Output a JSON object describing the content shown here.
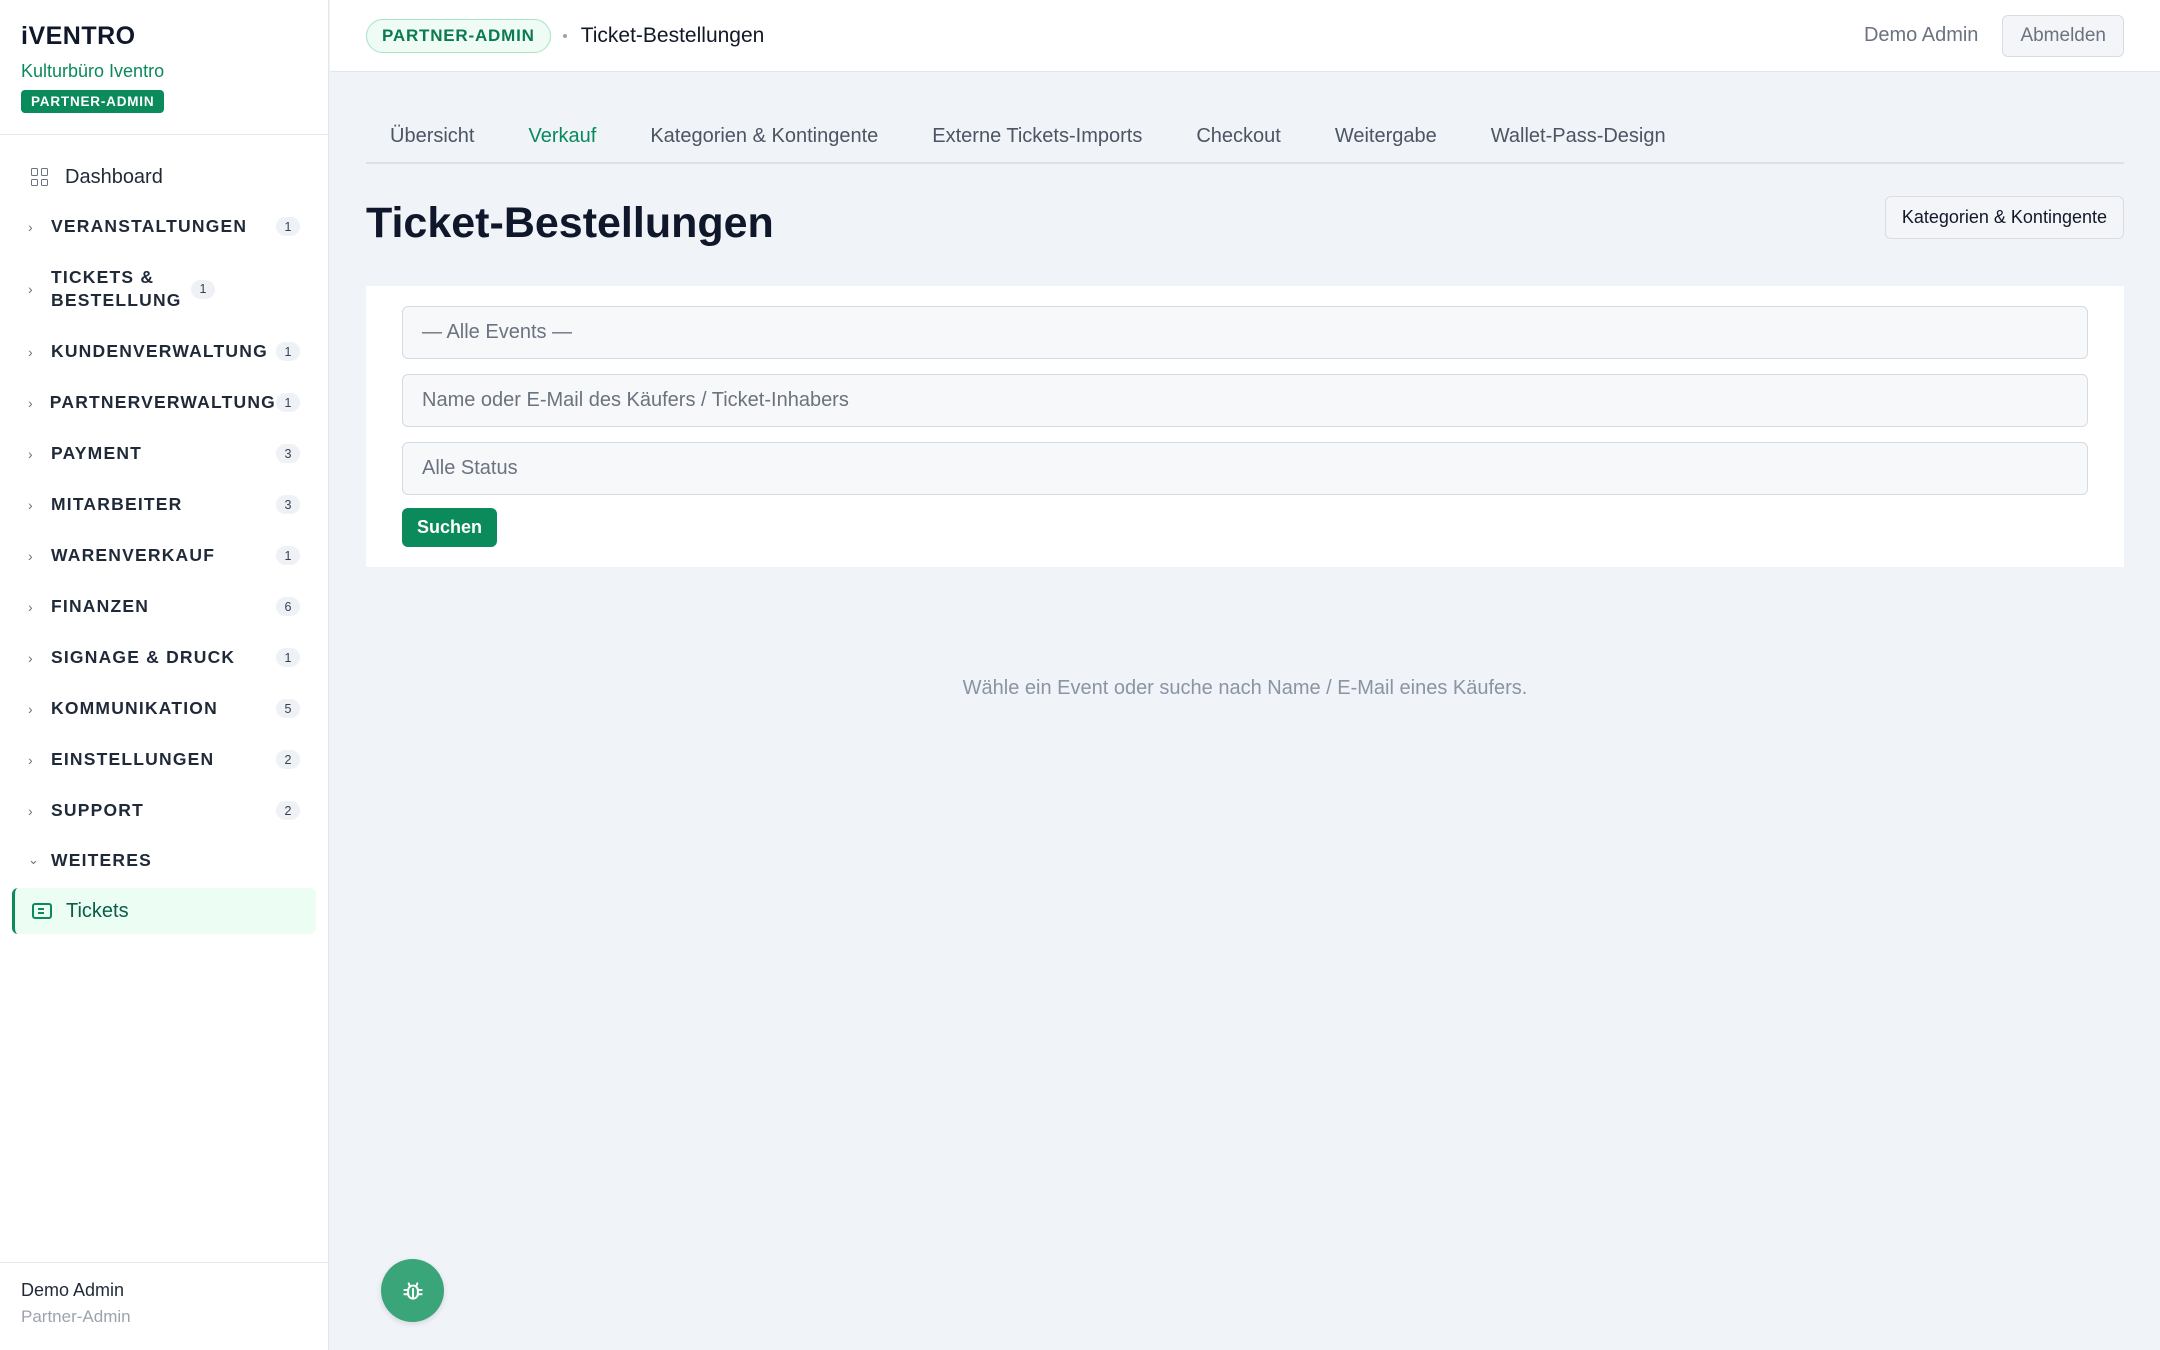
{
  "brand": {
    "logo": "iVENTRO",
    "org": "Kulturbüro Iventro",
    "role_badge": "PARTNER-ADMIN"
  },
  "sidebar": {
    "dashboard": {
      "label": "Dashboard",
      "icon": "grid-icon"
    },
    "sections": [
      {
        "label": "VERANSTALTUNGEN",
        "count": "1"
      },
      {
        "label": "TICKETS & BESTELLUNG",
        "count": "1"
      },
      {
        "label": "KUNDENVERWALTUNG",
        "count": "1"
      },
      {
        "label": "PARTNERVERWALTUNG",
        "count": "1"
      },
      {
        "label": "PAYMENT",
        "count": "3"
      },
      {
        "label": "MITARBEITER",
        "count": "3"
      },
      {
        "label": "WARENVERKAUF",
        "count": "1"
      },
      {
        "label": "FINANZEN",
        "count": "6"
      },
      {
        "label": "SIGNAGE & DRUCK",
        "count": "1"
      },
      {
        "label": "KOMMUNIKATION",
        "count": "5"
      },
      {
        "label": "EINSTELLUNGEN",
        "count": "2"
      },
      {
        "label": "SUPPORT",
        "count": "2"
      }
    ],
    "expanded_section": {
      "label": "WEITERES"
    },
    "active_item": {
      "label": "Tickets",
      "icon": "ticket-icon"
    },
    "footer": {
      "name": "Demo Admin",
      "role": "Partner-Admin"
    }
  },
  "topbar": {
    "role_pill": "PARTNER-ADMIN",
    "breadcrumb_title": "Ticket-Bestellungen",
    "user_name": "Demo Admin",
    "logout_label": "Abmelden"
  },
  "tabs": [
    {
      "label": "Übersicht",
      "active": false
    },
    {
      "label": "Verkauf",
      "active": true
    },
    {
      "label": "Kategorien & Kontingente",
      "active": false
    },
    {
      "label": "Externe Tickets-Imports",
      "active": false
    },
    {
      "label": "Checkout",
      "active": false
    },
    {
      "label": "Weitergabe",
      "active": false
    },
    {
      "label": "Wallet-Pass-Design",
      "active": false
    }
  ],
  "page": {
    "title": "Ticket-Bestellungen",
    "secondary_button": "Kategorien & Kontingente"
  },
  "filters": {
    "event_select": "— Alle Events —",
    "search_placeholder": "Name oder E-Mail des Käufers / Ticket-Inhabers",
    "status_select": "Alle Status",
    "submit_label": "Suchen"
  },
  "empty_state": "Wähle ein Event oder suche nach Name / E-Mail eines Käufers.",
  "fab": {
    "icon": "bug-icon"
  },
  "colors": {
    "accent": "#0b8a5c",
    "background": "#f0f3f7",
    "active_item_bg": "#ecfdf3"
  }
}
